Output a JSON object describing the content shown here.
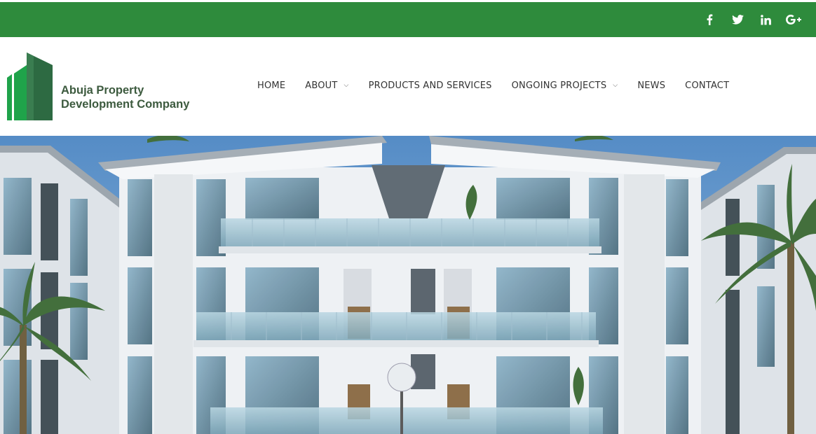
{
  "topbar": {
    "bg_color": "#2e8b3c",
    "social": [
      {
        "name": "facebook-icon",
        "glyph": "f"
      },
      {
        "name": "twitter-icon",
        "glyph": "twitter"
      },
      {
        "name": "linkedin-icon",
        "glyph": "in"
      },
      {
        "name": "google-plus-icon",
        "glyph": "G+"
      }
    ]
  },
  "logo": {
    "line1": "Abuja Property",
    "line2": "Development Company",
    "colors": {
      "light": "#1fa34a",
      "dark": "#2d6a42",
      "text": "#3c5a3e"
    }
  },
  "nav": {
    "home": "HOME",
    "about": "ABOUT",
    "products": "PRODUCTS AND SERVICES",
    "ongoing": "ONGOING PROJECTS",
    "news": "NEWS",
    "contact": "CONTACT"
  },
  "hero": {
    "image": "apartment-building-render"
  }
}
